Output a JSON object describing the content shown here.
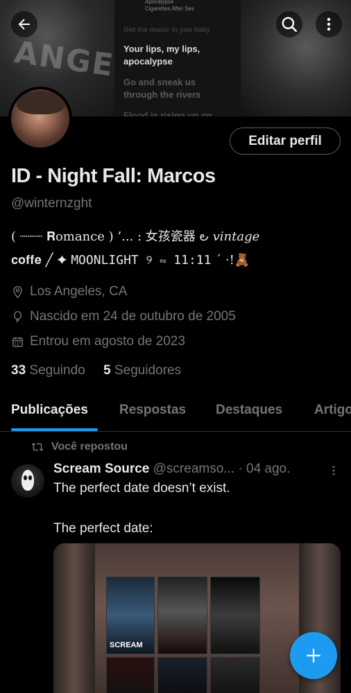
{
  "banner": {
    "song_title_small": "Apocalypse",
    "song_artist_small": "Cigarettes After Sex",
    "lyric_faint": "Got the music in you baby",
    "lyric_line1": "Your lips, my lips, apocalypse",
    "lyric_line2": "Go and sneak us through the rivers",
    "lyric_line3": "Flood is rising up on"
  },
  "profile": {
    "name": "ID - Night Fall: Marcos",
    "handle": "@winternzght",
    "edit_button": "Editar perfil",
    "bio_line1": "( ┈┈┈ 𝐑omance ) ’... : 女孩瓷器 ౿ 𝑣𝑖𝑛𝑡𝑎𝑔𝑒",
    "bio_line2_part1": "𝐜𝐨𝐟𝐟𝐞 ╱ ✦ ",
    "bio_line2_part2": "MOONLIGHT ୨ ∾ 11:11",
    "bio_line2_part3": " ´  ·!🧸",
    "location": "Los Angeles, CA",
    "birth": "Nascido em 24 de outubro de 2005",
    "joined": "Entrou em agosto de 2023",
    "following_count": "33",
    "following_label": "Seguindo",
    "followers_count": "5",
    "followers_label": "Seguidores"
  },
  "tabs": [
    "Publicações",
    "Respostas",
    "Destaques",
    "Artigos"
  ],
  "post": {
    "repost_label": "Você repostou",
    "author": "Scream Source",
    "handle_trunc": "@screamso...",
    "dot": "·",
    "date": "04 ago.",
    "text1": "The perfect date doesn’t exist.",
    "text2": "The perfect date:",
    "poster1": "SCREAM"
  },
  "colors": {
    "accent": "#1d9bf0",
    "muted": "#71767b",
    "text": "#e7e9ea",
    "background": "#000000"
  },
  "icons": [
    "back-arrow-icon",
    "search-icon",
    "more-vertical-icon",
    "location-icon",
    "balloon-icon",
    "calendar-icon",
    "repost-icon",
    "plus-icon"
  ]
}
